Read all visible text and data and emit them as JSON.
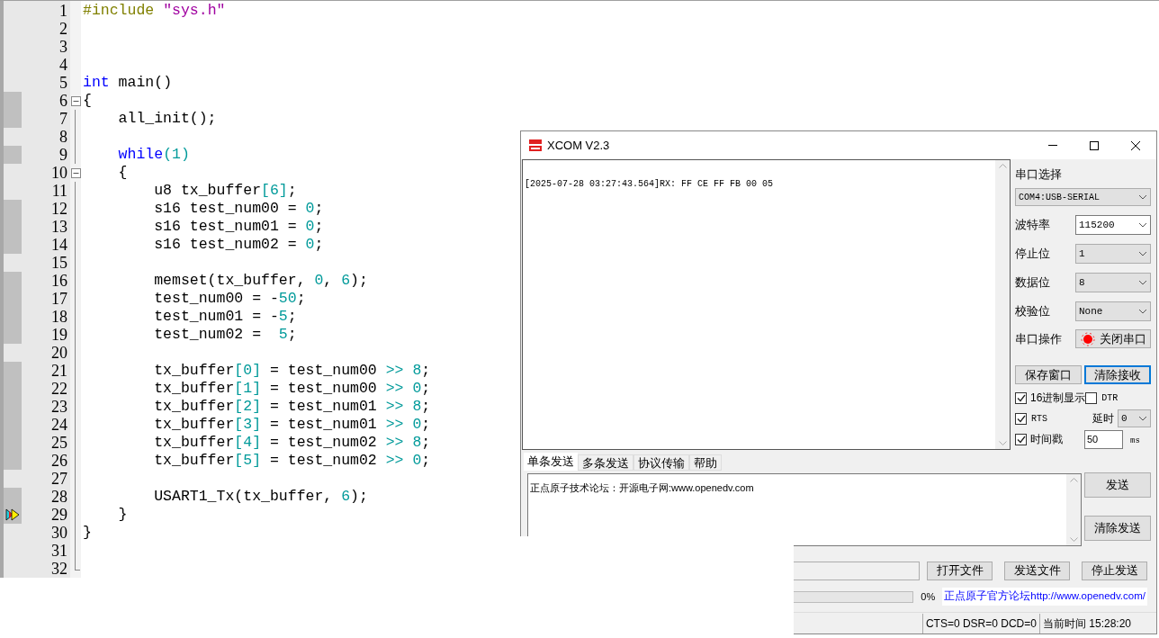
{
  "editor": {
    "lines": [
      {
        "number": "1",
        "tokens": [
          {
            "kind": "preproc",
            "text": "#include "
          },
          {
            "kind": "string",
            "text": "\"sys.h\""
          }
        ],
        "executable": false,
        "collapsible": false,
        "current": false
      },
      {
        "number": "2",
        "executable": false,
        "collapsible": false,
        "current": false
      },
      {
        "number": "3",
        "executable": false,
        "collapsible": false,
        "current": false
      },
      {
        "number": "4",
        "executable": false,
        "collapsible": false,
        "current": false
      },
      {
        "number": "5",
        "tokens": [
          {
            "kind": "keyword",
            "text": "int"
          },
          {
            "kind": "plain",
            "text": " main()"
          }
        ],
        "executable": false,
        "collapsible": false,
        "current": false
      },
      {
        "number": "6",
        "tokens": [
          {
            "kind": "plain",
            "text": "{"
          }
        ],
        "executable": true,
        "collapsible": true,
        "current": false
      },
      {
        "number": "7",
        "tokens": [
          {
            "kind": "plain",
            "text": "    all_init();"
          }
        ],
        "executable": true,
        "collapsible": false,
        "current": false
      },
      {
        "number": "8",
        "executable": false,
        "collapsible": false,
        "current": false
      },
      {
        "number": "9",
        "tokens": [
          {
            "kind": "keyword",
            "text": "    while"
          },
          {
            "kind": "number",
            "text": "(1)"
          }
        ],
        "executable": true,
        "collapsible": false,
        "current": false
      },
      {
        "number": "10",
        "tokens": [
          {
            "kind": "plain",
            "text": "    {"
          }
        ],
        "executable": false,
        "collapsible": true,
        "current": false
      },
      {
        "number": "11",
        "tokens": [
          {
            "kind": "plain",
            "text": "        u8 tx_buffer"
          },
          {
            "kind": "number",
            "text": "[6]"
          },
          {
            "kind": "plain",
            "text": ";"
          }
        ],
        "executable": false,
        "collapsible": false,
        "current": false
      },
      {
        "number": "12",
        "tokens": [
          {
            "kind": "plain",
            "text": "        s16 test_num00 = "
          },
          {
            "kind": "number",
            "text": "0"
          },
          {
            "kind": "plain",
            "text": ";"
          }
        ],
        "executable": true,
        "collapsible": false,
        "current": false
      },
      {
        "number": "13",
        "tokens": [
          {
            "kind": "plain",
            "text": "        s16 test_num01 = "
          },
          {
            "kind": "number",
            "text": "0"
          },
          {
            "kind": "plain",
            "text": ";"
          }
        ],
        "executable": true,
        "collapsible": false,
        "current": false
      },
      {
        "number": "14",
        "tokens": [
          {
            "kind": "plain",
            "text": "        s16 test_num02 = "
          },
          {
            "kind": "number",
            "text": "0"
          },
          {
            "kind": "plain",
            "text": ";"
          }
        ],
        "executable": true,
        "collapsible": false,
        "current": false
      },
      {
        "number": "15",
        "executable": false,
        "collapsible": false,
        "current": false
      },
      {
        "number": "16",
        "tokens": [
          {
            "kind": "plain",
            "text": "        memset(tx_buffer, "
          },
          {
            "kind": "number",
            "text": "0"
          },
          {
            "kind": "plain",
            "text": ", "
          },
          {
            "kind": "number",
            "text": "6"
          },
          {
            "kind": "plain",
            "text": ");"
          }
        ],
        "executable": true,
        "collapsible": false,
        "current": false
      },
      {
        "number": "17",
        "tokens": [
          {
            "kind": "plain",
            "text": "        test_num00 = -"
          },
          {
            "kind": "number",
            "text": "50"
          },
          {
            "kind": "plain",
            "text": ";"
          }
        ],
        "executable": true,
        "collapsible": false,
        "current": false
      },
      {
        "number": "18",
        "tokens": [
          {
            "kind": "plain",
            "text": "        test_num01 = -"
          },
          {
            "kind": "number",
            "text": "5"
          },
          {
            "kind": "plain",
            "text": ";"
          }
        ],
        "executable": true,
        "collapsible": false,
        "current": false
      },
      {
        "number": "19",
        "tokens": [
          {
            "kind": "plain",
            "text": "        test_num02 =  "
          },
          {
            "kind": "number",
            "text": "5"
          },
          {
            "kind": "plain",
            "text": ";"
          }
        ],
        "executable": true,
        "collapsible": false,
        "current": false
      },
      {
        "number": "20",
        "executable": false,
        "collapsible": false,
        "current": false
      },
      {
        "number": "21",
        "tokens": [
          {
            "kind": "plain",
            "text": "        tx_buffer"
          },
          {
            "kind": "number",
            "text": "[0]"
          },
          {
            "kind": "plain",
            "text": " = test_num00 "
          },
          {
            "kind": "number",
            "text": ">> 8"
          },
          {
            "kind": "plain",
            "text": ";"
          }
        ],
        "executable": true,
        "collapsible": false,
        "current": false
      },
      {
        "number": "22",
        "tokens": [
          {
            "kind": "plain",
            "text": "        tx_buffer"
          },
          {
            "kind": "number",
            "text": "[1]"
          },
          {
            "kind": "plain",
            "text": " = test_num00 "
          },
          {
            "kind": "number",
            "text": ">> 0"
          },
          {
            "kind": "plain",
            "text": ";"
          }
        ],
        "executable": true,
        "collapsible": false,
        "current": false
      },
      {
        "number": "23",
        "tokens": [
          {
            "kind": "plain",
            "text": "        tx_buffer"
          },
          {
            "kind": "number",
            "text": "[2]"
          },
          {
            "kind": "plain",
            "text": " = test_num01 "
          },
          {
            "kind": "number",
            "text": ">> 8"
          },
          {
            "kind": "plain",
            "text": ";"
          }
        ],
        "executable": true,
        "collapsible": false,
        "current": false
      },
      {
        "number": "24",
        "tokens": [
          {
            "kind": "plain",
            "text": "        tx_buffer"
          },
          {
            "kind": "number",
            "text": "[3]"
          },
          {
            "kind": "plain",
            "text": " = test_num01 "
          },
          {
            "kind": "number",
            "text": ">> 0"
          },
          {
            "kind": "plain",
            "text": ";"
          }
        ],
        "executable": true,
        "collapsible": false,
        "current": false
      },
      {
        "number": "25",
        "tokens": [
          {
            "kind": "plain",
            "text": "        tx_buffer"
          },
          {
            "kind": "number",
            "text": "[4]"
          },
          {
            "kind": "plain",
            "text": " = test_num02 "
          },
          {
            "kind": "number",
            "text": ">> 8"
          },
          {
            "kind": "plain",
            "text": ";"
          }
        ],
        "executable": true,
        "collapsible": false,
        "current": false
      },
      {
        "number": "26",
        "tokens": [
          {
            "kind": "plain",
            "text": "        tx_buffer"
          },
          {
            "kind": "number",
            "text": "[5]"
          },
          {
            "kind": "plain",
            "text": " = test_num02 "
          },
          {
            "kind": "number",
            "text": ">> 0"
          },
          {
            "kind": "plain",
            "text": ";"
          }
        ],
        "executable": true,
        "collapsible": false,
        "current": false
      },
      {
        "number": "27",
        "executable": false,
        "collapsible": false,
        "current": false
      },
      {
        "number": "28",
        "tokens": [
          {
            "kind": "plain",
            "text": "        USART1_Tx(tx_buffer, "
          },
          {
            "kind": "number",
            "text": "6"
          },
          {
            "kind": "plain",
            "text": ");"
          }
        ],
        "executable": true,
        "collapsible": false,
        "current": false
      },
      {
        "number": "29",
        "tokens": [
          {
            "kind": "plain",
            "text": "    }"
          }
        ],
        "executable": true,
        "collapsible": false,
        "current": true
      },
      {
        "number": "30",
        "tokens": [
          {
            "kind": "plain",
            "text": "}"
          }
        ],
        "executable": false,
        "collapsible": false,
        "current": false
      },
      {
        "number": "31",
        "executable": false,
        "collapsible": false,
        "current": false
      },
      {
        "number": "32",
        "executable": false,
        "collapsible": false,
        "current": false
      }
    ]
  },
  "xcom": {
    "title": "XCOM V2.3",
    "receive_text": "[2025-07-28 03:27:43.564]RX: FF CE FF FB 00 05",
    "port_label": "串口选择",
    "port_value": "COM4:USB-SERIAL",
    "settings": [
      {
        "label": "波特率",
        "value": "115200",
        "editable": true
      },
      {
        "label": "停止位",
        "value": "1",
        "editable": false
      },
      {
        "label": "数据位",
        "value": "8",
        "editable": false
      },
      {
        "label": "校验位",
        "value": "None",
        "editable": false
      }
    ],
    "operation_label": "串口操作",
    "operation_button": "关闭串口",
    "port_open": true,
    "receive_buttons": [
      {
        "label": "保存窗口",
        "focused": false
      },
      {
        "label": "清除接收",
        "focused": true
      }
    ],
    "hex_display": {
      "label": "16进制显示",
      "checked": true
    },
    "dtr": {
      "label": "DTR",
      "checked": false
    },
    "rts": {
      "label": "RTS",
      "checked": true
    },
    "delay_label": "延时",
    "delay_value": "0",
    "timestamp": {
      "label": "时间戳",
      "checked": true
    },
    "interval_value": "50",
    "interval_unit": "ms",
    "tabs": [
      {
        "label": "单条发送",
        "selected": true
      },
      {
        "label": "多条发送",
        "selected": false
      },
      {
        "label": "协议传输",
        "selected": false
      },
      {
        "label": "帮助",
        "selected": false
      }
    ],
    "send_text": "正点原子技术论坛：开源电子网:www.openedv.com",
    "send_buttons": [
      "发送",
      "清除发送"
    ],
    "file_buttons": [
      "打开文件",
      "发送文件",
      "停止发送"
    ],
    "progress": {
      "level": 0,
      "reading": "0%"
    },
    "forum_link": "正点原子官方论坛http://www.openedv.com/",
    "status_lines": "CTS=0 DSR=0 DCD=0",
    "status_time": "当前时间 15:28:20"
  }
}
